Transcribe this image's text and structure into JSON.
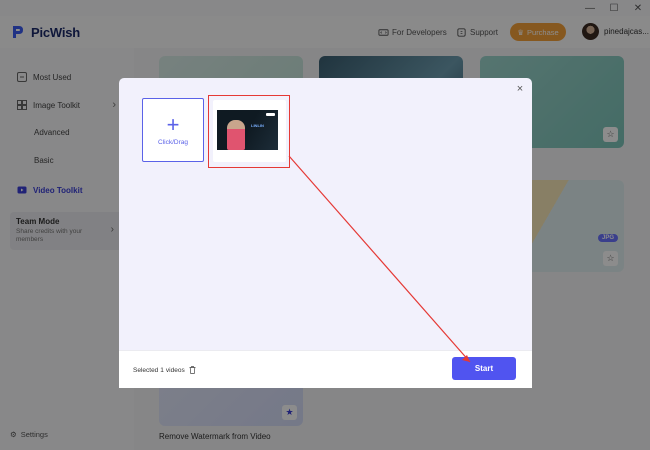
{
  "app": {
    "name": "PicWish",
    "brand_color": "#1d2b6b",
    "accent_color": "#5054f0"
  },
  "window_controls": {
    "minimize": "—",
    "maximize": "☐",
    "close": "✕"
  },
  "header": {
    "developers_label": "For Developers",
    "support_label": "Support",
    "purchase_label": "Purchase",
    "purchase_color": "#f5a13a",
    "username": "pinedajcas..."
  },
  "sidebar": {
    "items": [
      {
        "label": "Most Used",
        "icon": "grid-icon"
      },
      {
        "label": "Image Toolkit",
        "icon": "image-toolkit-icon",
        "chevron": "›"
      },
      {
        "label": "Advanced"
      },
      {
        "label": "Basic"
      },
      {
        "label": "Video Toolkit",
        "icon": "video-icon",
        "active": true
      }
    ],
    "team": {
      "title": "Team Mode",
      "description": "Share credits with your members",
      "chevron": "›"
    },
    "settings_label": "Settings"
  },
  "background": {
    "card_caption": "Remove Watermark from Video",
    "jpg_badge": "JPG",
    "star": "☆",
    "star_filled": "★"
  },
  "modal": {
    "close_glyph": "×",
    "add_plus": "+",
    "add_label": "Click/Drag",
    "thumb_text": "LINLIN",
    "selected_prefix": "Selected",
    "selected_count": "1",
    "selected_suffix": "videos",
    "start_label": "Start",
    "highlight_color": "#e53935"
  }
}
